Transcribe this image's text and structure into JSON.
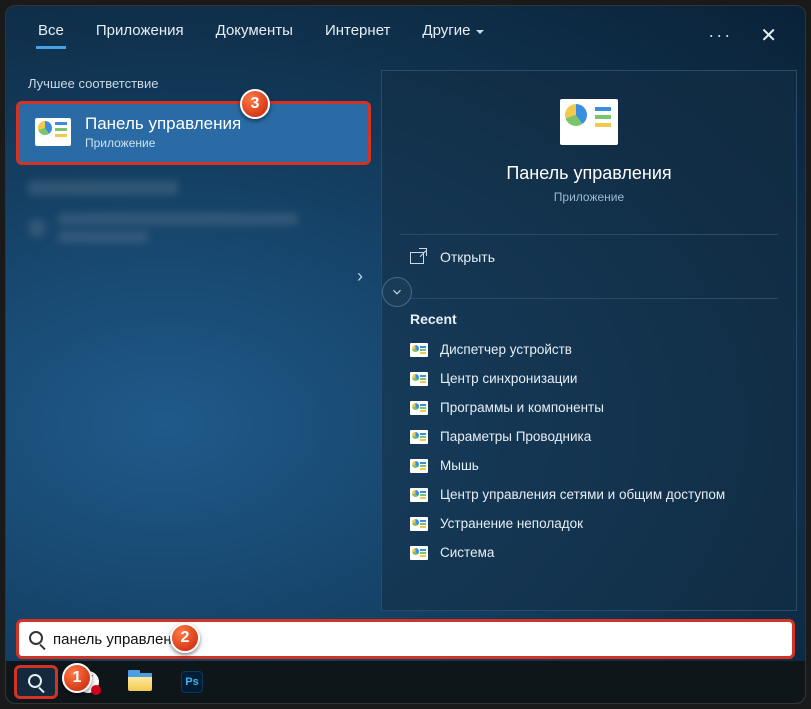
{
  "tabs": {
    "all": "Все",
    "apps": "Приложения",
    "docs": "Документы",
    "web": "Интернет",
    "more": "Другие"
  },
  "left": {
    "best_match_label": "Лучшее соответствие",
    "result": {
      "title": "Панель управления",
      "subtitle": "Приложение"
    }
  },
  "right": {
    "hero_title": "Панель управления",
    "hero_subtitle": "Приложение",
    "open_label": "Открыть",
    "recent_label": "Recent",
    "recent": [
      "Диспетчер устройств",
      "Центр синхронизации",
      "Программы и компоненты",
      "Параметры Проводника",
      "Мышь",
      "Центр управления сетями и общим доступом",
      "Устранение неполадок",
      "Система"
    ]
  },
  "search": {
    "value": "панель управления"
  },
  "taskbar": {
    "yandex_label": "Y",
    "ps_label": "Ps"
  },
  "annotations": {
    "b1": "1",
    "b2": "2",
    "b3": "3"
  }
}
